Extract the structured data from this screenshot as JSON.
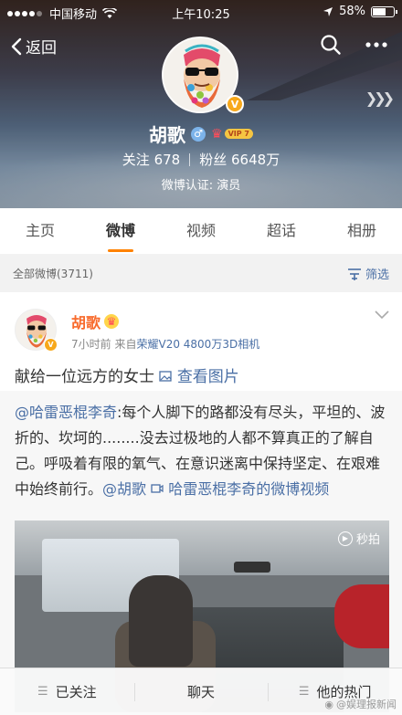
{
  "statusbar": {
    "carrier": "中国移动",
    "time": "上午10:25",
    "battery": "58%"
  },
  "nav": {
    "back_label": "返回"
  },
  "profile": {
    "name": "胡歌",
    "vip_label": "VIP 7",
    "following_label": "关注",
    "following_count": "678",
    "followers_label": "粉丝",
    "followers_count": "6648万",
    "certification": "微博认证: 演员"
  },
  "tabs": [
    {
      "label": "主页"
    },
    {
      "label": "微博",
      "active": true
    },
    {
      "label": "视频"
    },
    {
      "label": "超话"
    },
    {
      "label": "相册"
    }
  ],
  "filter_bar": {
    "all_posts": "全部微博(3711)",
    "filter_label": "筛选"
  },
  "post": {
    "author": "胡歌",
    "time": "7小时前",
    "source_prefix": "来自",
    "source": "荣耀V20 4800万3D相机",
    "text": "献给一位远方的女士",
    "image_link": "查看图片",
    "repost": {
      "author_mention": "@哈雷恶棍李奇",
      "body": ":每个人脚下的路都没有尽头，平坦的、波折的、坎坷的........没去过极地的人都不算真正的了解自己。呼吸着有限的氧气、在意识迷离中保持坚定、在艰难中始终前行。",
      "mention": "@胡歌",
      "video_link": "哈雷恶棍李奇的微博视频"
    },
    "video_watermark": "秒拍"
  },
  "bottom_bar": {
    "followed_label": "已关注",
    "chat_label": "聊天",
    "hot_label": "他的热门"
  },
  "watermark": "@娱理报新闻",
  "colors": {
    "accent": "#ff8200",
    "link": "#4a6fa5",
    "name": "#f86a2b"
  }
}
